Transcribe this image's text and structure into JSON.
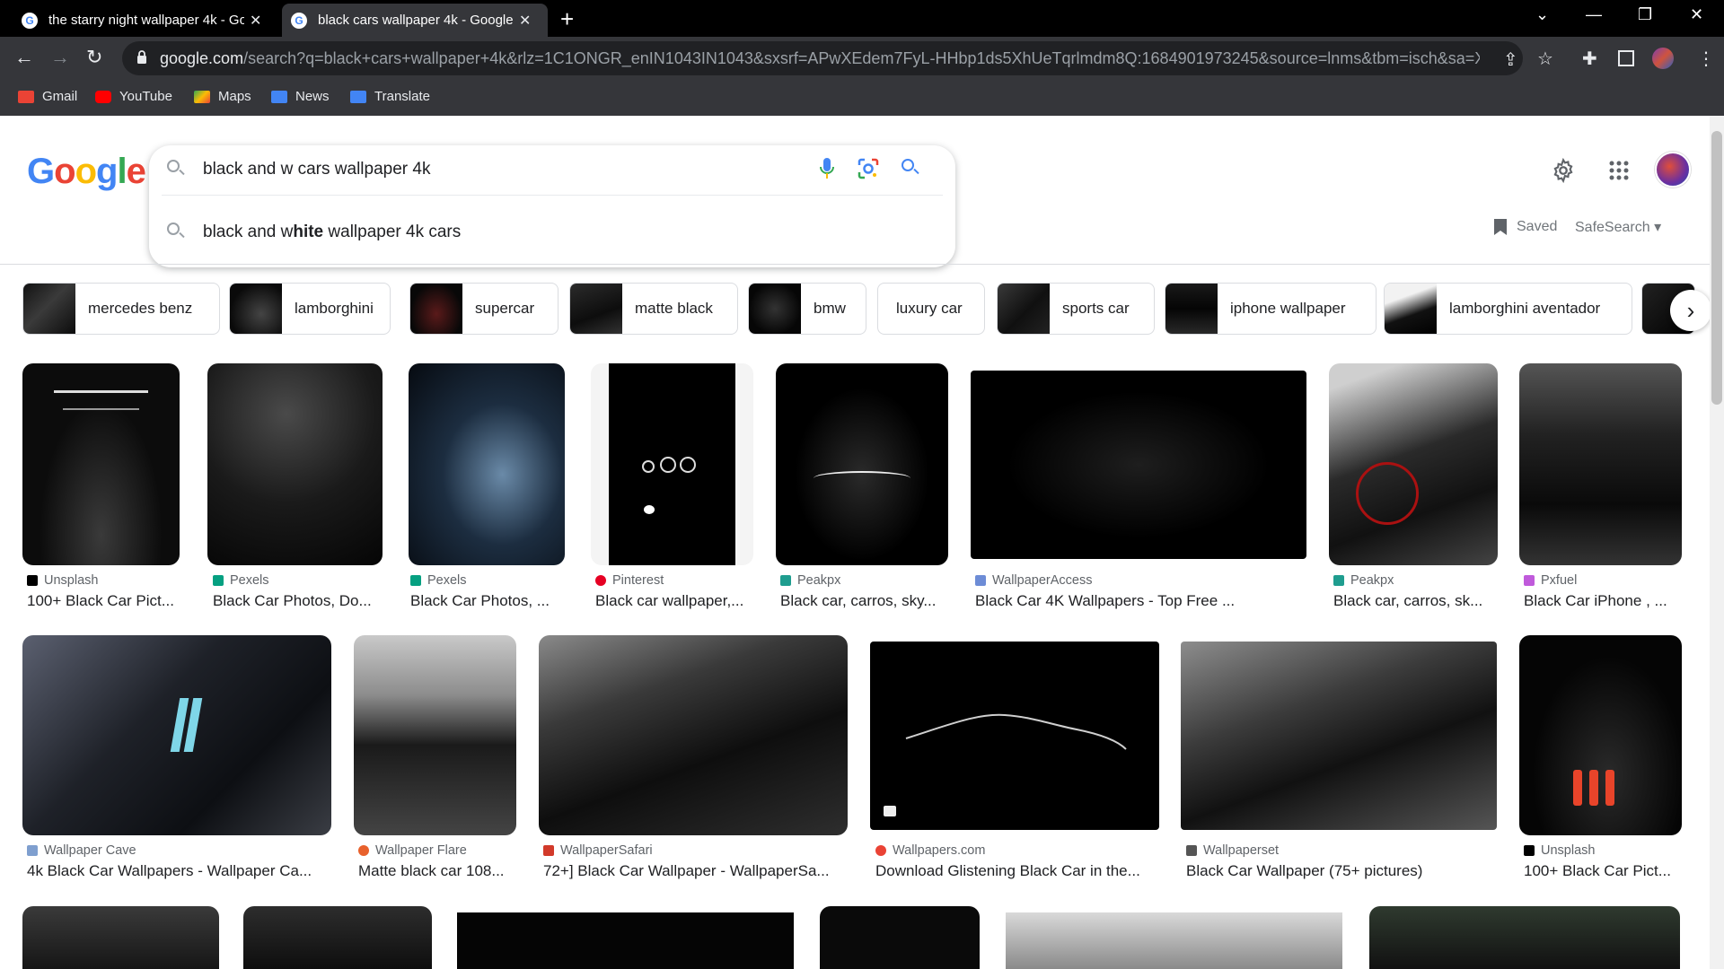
{
  "browser": {
    "tabs": [
      {
        "title": "the starry night wallpaper 4k - Go",
        "active": false
      },
      {
        "title": "black cars wallpaper 4k - Google",
        "active": true
      }
    ],
    "new_tab": "+",
    "url_host": "google.com",
    "url_rest": "/search?q=black+cars+wallpaper+4k&rlz=1C1ONGR_enIN1043IN1043&sxsrf=APwXEdem7FyL-HHbp1ds5XhUeTqrlmdm8Q:1684901973245&source=lnms&tbm=isch&sa=X&ved...",
    "bookmarks": [
      {
        "label": "Gmail",
        "color": "#ea4335"
      },
      {
        "label": "YouTube",
        "color": "#ff0000"
      },
      {
        "label": "Maps",
        "color": "#34a853"
      },
      {
        "label": "News",
        "color": "#4285f4"
      },
      {
        "label": "Translate",
        "color": "#4285f4"
      }
    ]
  },
  "google": {
    "logo": "Google",
    "query": "black and w cars wallpaper 4k",
    "suggestion_prefix": "black and w",
    "suggestion_bold": "hite",
    "suggestion_suffix": " wallpaper 4k cars",
    "saved_label": "Saved",
    "safesearch_label": "SafeSearch"
  },
  "chips": [
    {
      "label": "mercedes benz",
      "thumb": true
    },
    {
      "label": "lamborghini",
      "thumb": true
    },
    {
      "label": "supercar",
      "thumb": true
    },
    {
      "label": "matte black",
      "thumb": true
    },
    {
      "label": "bmw",
      "thumb": true
    },
    {
      "label": "luxury car",
      "thumb": false
    },
    {
      "label": "sports car",
      "thumb": true
    },
    {
      "label": "iphone wallpaper",
      "thumb": true
    },
    {
      "label": "lamborghini aventador",
      "thumb": true
    }
  ],
  "row1": [
    {
      "source": "Unsplash",
      "title": "100+ Black Car Pict...",
      "icon_color": "#000000"
    },
    {
      "source": "Pexels",
      "title": "Black Car Photos, Do...",
      "icon_color": "#05a081"
    },
    {
      "source": "Pexels",
      "title": "Black Car Photos, ...",
      "icon_color": "#05a081"
    },
    {
      "source": "Pinterest",
      "title": "Black car wallpaper,...",
      "icon_color": "#e60023"
    },
    {
      "source": "Peakpx",
      "title": "Black car, carros, sky...",
      "icon_color": "#1f9d8f"
    },
    {
      "source": "WallpaperAccess",
      "title": "Black Car 4K Wallpapers - Top Free ...",
      "icon_color": "#6d8cd6"
    },
    {
      "source": "Peakpx",
      "title": "Black car, carros, sk...",
      "icon_color": "#1f9d8f"
    },
    {
      "source": "Pxfuel",
      "title": "Black Car iPhone , ...",
      "icon_color": "#c05adb"
    }
  ],
  "row2": [
    {
      "source": "Wallpaper Cave",
      "title": "4k Black Car Wallpapers - Wallpaper Ca...",
      "icon_color": "#7f9fcf"
    },
    {
      "source": "Wallpaper Flare",
      "title": "Matte black car 108...",
      "icon_color": "#e8612c"
    },
    {
      "source": "WallpaperSafari",
      "title": "72+] Black Car Wallpaper - WallpaperSa...",
      "icon_color": "#d23a2a"
    },
    {
      "source": "Wallpapers.com",
      "title": "Download Glistening Black Car in the...",
      "icon_color": "#ea4335"
    },
    {
      "source": "Wallpaperset",
      "title": "Black Car Wallpaper (75+ pictures)",
      "icon_color": "#555555"
    },
    {
      "source": "Unsplash",
      "title": "100+ Black Car Pict...",
      "icon_color": "#000000"
    }
  ],
  "colors": {
    "google_blue": "#4285f4",
    "google_red": "#ea4335",
    "google_yellow": "#fbbc05",
    "google_green": "#34a853"
  }
}
